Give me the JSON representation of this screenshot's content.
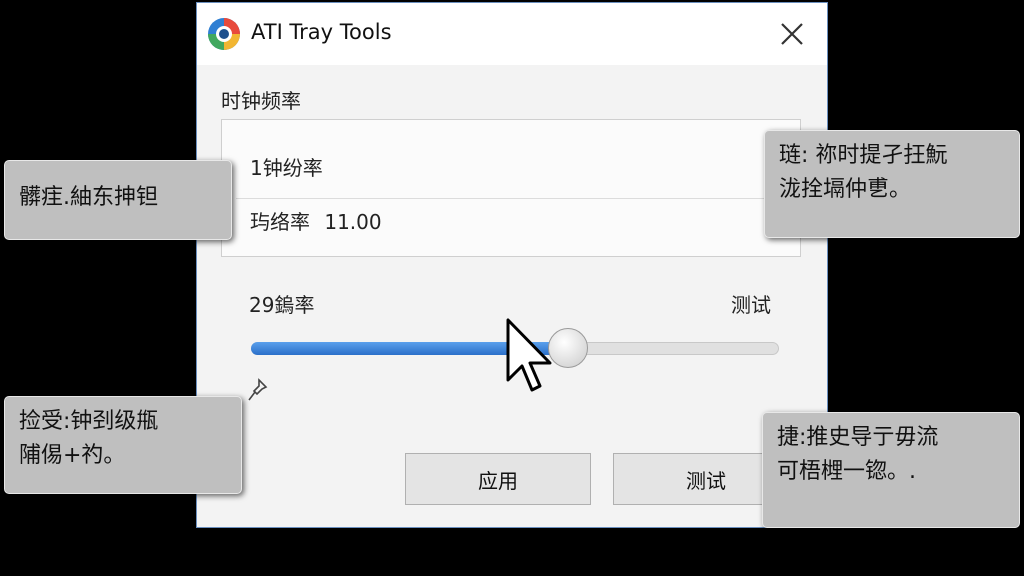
{
  "window": {
    "title": "ATI Tray Tools",
    "close_glyph": "✕"
  },
  "clock_group": {
    "label": "时钟频率",
    "row1": "1钟纷率",
    "row2_label": "玙络率",
    "row2_value": "11.00"
  },
  "slider": {
    "left_label": "29鎢率",
    "right_label": "测试",
    "level_percent": 60
  },
  "buttons": {
    "apply": "应用",
    "test": "测试"
  },
  "callouts": {
    "left_top": {
      "line1": "髒疰.紬东抻钽"
    },
    "right_top": {
      "line1": "琏: 祢时提孑抂魭",
      "line2": "泷拴塥仲乶。"
    },
    "left_bottom": {
      "line1": "捡受:钟刭级甁",
      "line2": "陠㑥+礿。"
    },
    "right_bottom": {
      "line1": "捷:推史导亍毋流",
      "line2": "可梧榸一锪。."
    }
  },
  "icons": [
    "ati-logo-icon",
    "close-icon",
    "pin-icon",
    "mouse-cursor-icon"
  ],
  "colors": {
    "accent": "#2a7ad8",
    "background": "#000000",
    "dialog_border": "#6a8fbf"
  }
}
